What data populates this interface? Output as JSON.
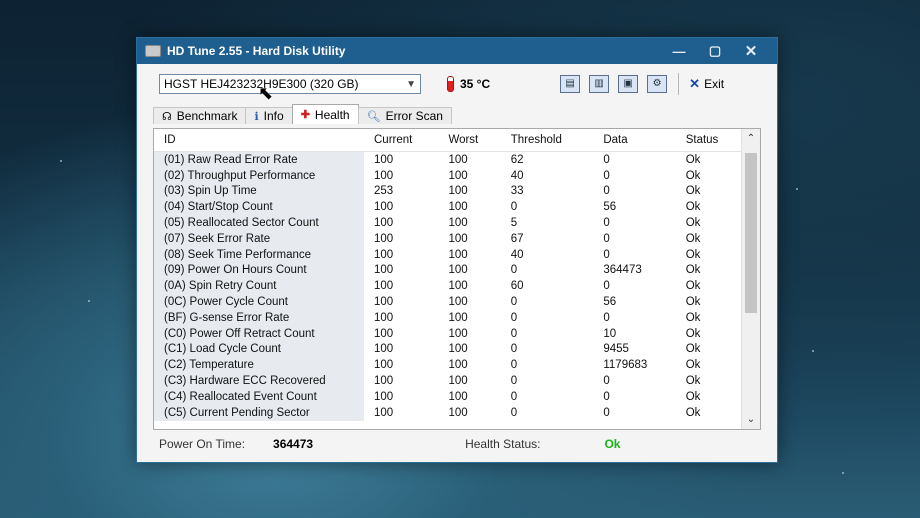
{
  "window": {
    "title": "HD Tune 2.55 - Hard Disk Utility",
    "minimize": "—",
    "maximize": "▢",
    "close": "✕"
  },
  "toolbar": {
    "drive": "HGST   HEJ423232H9E300 (320 GB)",
    "temperature": "35 °C",
    "exit_label": "Exit"
  },
  "tabs": [
    {
      "label": "Benchmark",
      "icon": "gauge-icon"
    },
    {
      "label": "Info",
      "icon": "info-icon"
    },
    {
      "label": "Health",
      "icon": "health-cross-icon"
    },
    {
      "label": "Error Scan",
      "icon": "magnifier-icon"
    }
  ],
  "active_tab": "Health",
  "table": {
    "columns": [
      "ID",
      "Current",
      "Worst",
      "Threshold",
      "Data",
      "Status"
    ],
    "rows": [
      [
        "(01) Raw Read Error Rate",
        "100",
        "100",
        "62",
        "0",
        "Ok"
      ],
      [
        "(02) Throughput Performance",
        "100",
        "100",
        "40",
        "0",
        "Ok"
      ],
      [
        "(03) Spin Up Time",
        "253",
        "100",
        "33",
        "0",
        "Ok"
      ],
      [
        "(04) Start/Stop Count",
        "100",
        "100",
        "0",
        "56",
        "Ok"
      ],
      [
        "(05) Reallocated Sector Count",
        "100",
        "100",
        "5",
        "0",
        "Ok"
      ],
      [
        "(07) Seek Error Rate",
        "100",
        "100",
        "67",
        "0",
        "Ok"
      ],
      [
        "(08) Seek Time Performance",
        "100",
        "100",
        "40",
        "0",
        "Ok"
      ],
      [
        "(09) Power On Hours Count",
        "100",
        "100",
        "0",
        "364473",
        "Ok"
      ],
      [
        "(0A) Spin Retry Count",
        "100",
        "100",
        "60",
        "0",
        "Ok"
      ],
      [
        "(0C) Power Cycle Count",
        "100",
        "100",
        "0",
        "56",
        "Ok"
      ],
      [
        "(BF) G-sense Error Rate",
        "100",
        "100",
        "0",
        "0",
        "Ok"
      ],
      [
        "(C0) Power Off Retract Count",
        "100",
        "100",
        "0",
        "10",
        "Ok"
      ],
      [
        "(C1) Load Cycle Count",
        "100",
        "100",
        "0",
        "9455",
        "Ok"
      ],
      [
        "(C2) Temperature",
        "100",
        "100",
        "0",
        "1179683",
        "Ok"
      ],
      [
        "(C3) Hardware ECC Recovered",
        "100",
        "100",
        "0",
        "0",
        "Ok"
      ],
      [
        "(C4) Reallocated Event Count",
        "100",
        "100",
        "0",
        "0",
        "Ok"
      ],
      [
        "(C5) Current Pending Sector",
        "100",
        "100",
        "0",
        "0",
        "Ok"
      ]
    ]
  },
  "status": {
    "power_on_label": "Power On Time:",
    "power_on_value": "364473",
    "health_label": "Health Status:",
    "health_value": "Ok",
    "health_color": "#17b51b"
  }
}
